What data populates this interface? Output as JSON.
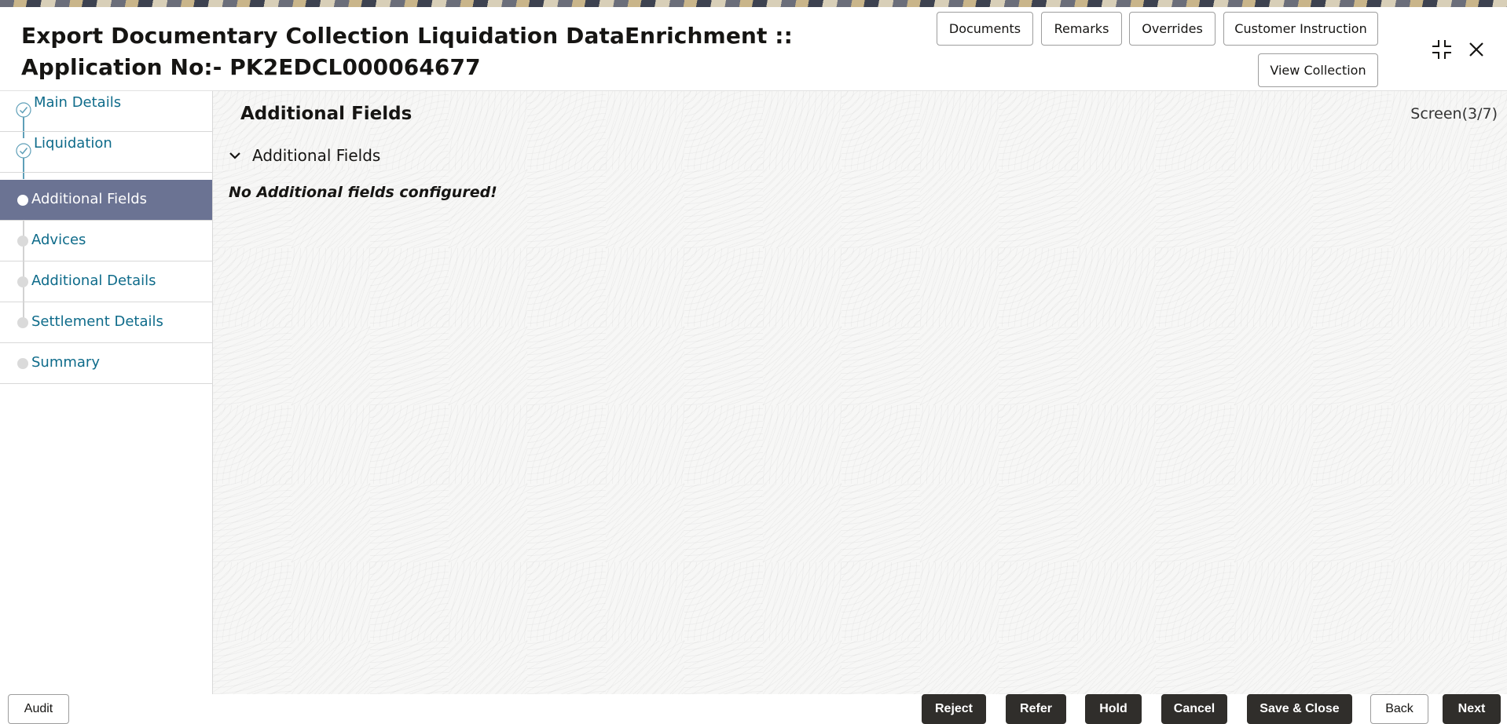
{
  "header": {
    "title": "Export Documentary Collection Liquidation DataEnrichment :: Application No:- PK2EDCL000064677",
    "buttons": {
      "documents": "Documents",
      "remarks": "Remarks",
      "overrides": "Overrides",
      "customer_instruction": "Customer Instruction",
      "view_collection": "View Collection"
    }
  },
  "sidebar": {
    "items": [
      {
        "label": "Main Details",
        "state": "completed"
      },
      {
        "label": "Liquidation",
        "state": "completed"
      },
      {
        "label": "Additional Fields",
        "state": "active"
      },
      {
        "label": "Advices",
        "state": "pending"
      },
      {
        "label": "Additional Details",
        "state": "pending"
      },
      {
        "label": "Settlement Details",
        "state": "pending"
      },
      {
        "label": "Summary",
        "state": "pending"
      }
    ]
  },
  "main": {
    "section_title": "Additional Fields",
    "screen_indicator": "Screen(3/7)",
    "collapsible_label": "Additional Fields",
    "empty_message": "No Additional fields configured!"
  },
  "footer": {
    "audit": "Audit",
    "reject": "Reject",
    "refer": "Refer",
    "hold": "Hold",
    "cancel": "Cancel",
    "save_close": "Save & Close",
    "back": "Back",
    "next": "Next"
  },
  "colors": {
    "accent": "#0e6b8a",
    "active_nav": "#6b7393",
    "dark_button": "#302e2b"
  },
  "icons": {
    "collapse": "collapse-icon",
    "close": "close-icon",
    "check": "check-circle-icon",
    "chevron": "chevron-down-icon"
  }
}
